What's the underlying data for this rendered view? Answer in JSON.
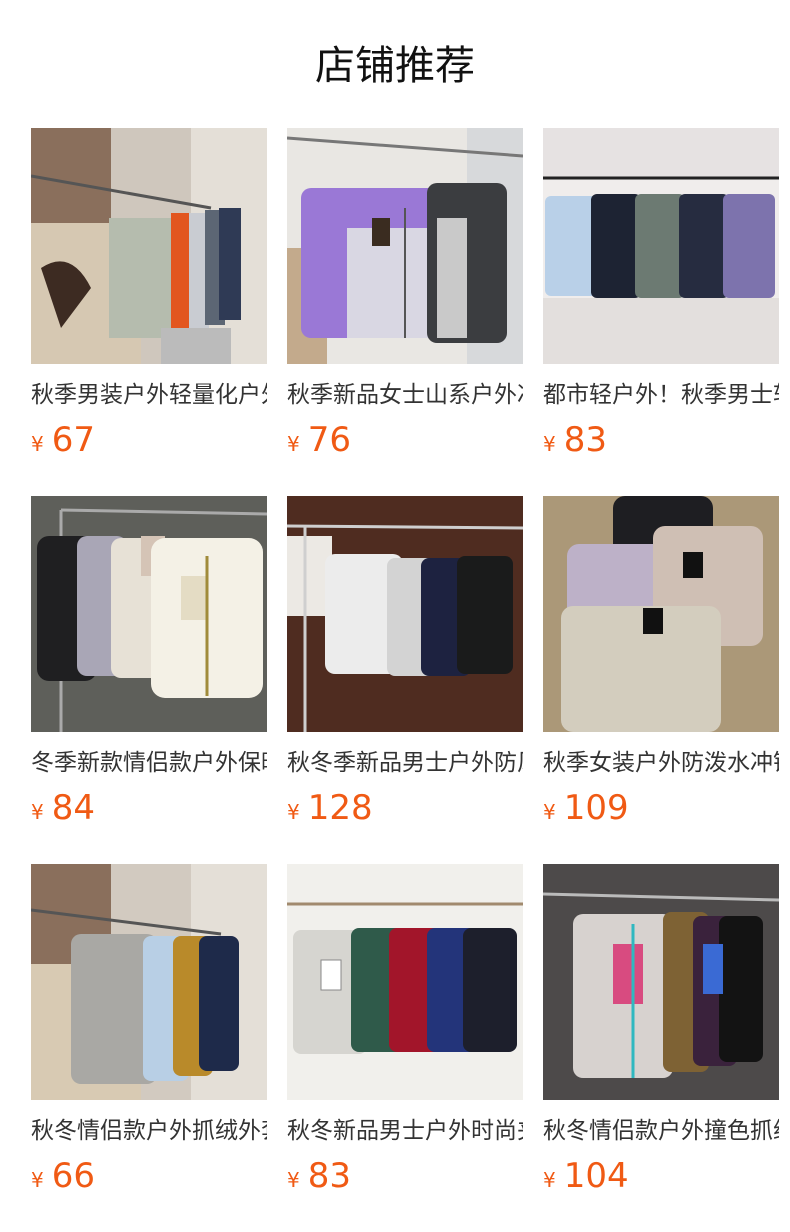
{
  "header": {
    "title": "店铺推荐"
  },
  "currency_symbol": "¥",
  "colors": {
    "price": "#f05a14"
  },
  "products": [
    {
      "name": "秋季男装户外轻量化户外夹克",
      "price": "67"
    },
    {
      "name": "秋季新品女士山系户外冲锋衣",
      "price": "76"
    },
    {
      "name": "都市轻户外！秋季男士软壳夹克",
      "price": "83"
    },
    {
      "name": "冬季新款情侣款户外保暖棉服",
      "price": "84"
    },
    {
      "name": "秋冬季新品男士户外防风夹克",
      "price": "128"
    },
    {
      "name": "秋季女装户外防泼水冲锋衣",
      "price": "109"
    },
    {
      "name": "秋冬情侣款户外抓绒外套",
      "price": "66"
    },
    {
      "name": "秋冬新品男士户外时尚夹克",
      "price": "83"
    },
    {
      "name": "秋冬情侣款户外撞色抓绒衣",
      "price": "104"
    }
  ]
}
